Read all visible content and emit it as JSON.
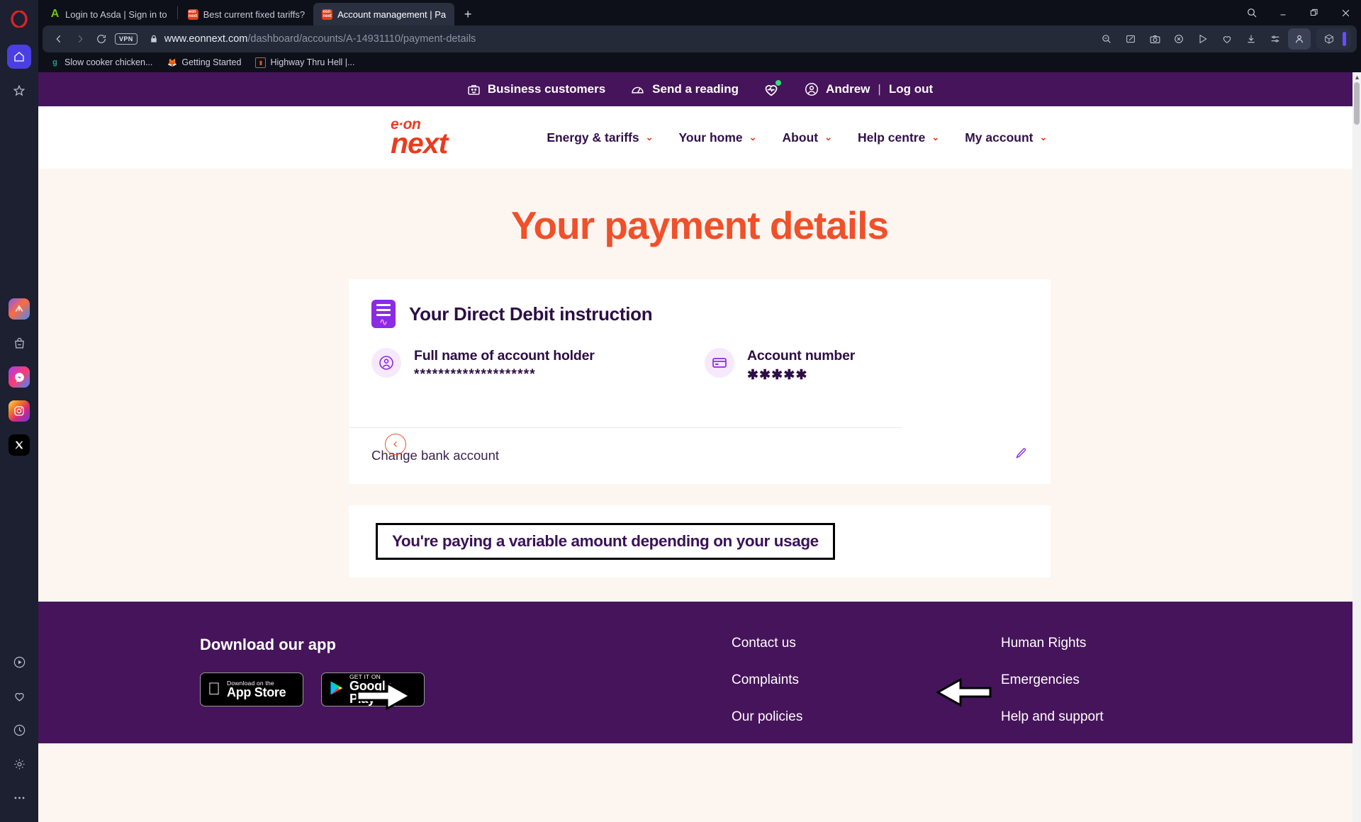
{
  "browser": {
    "tabs": [
      {
        "title": "Login to Asda | Sign in to",
        "favicon": "asda-icon",
        "active": false
      },
      {
        "title": "Best current fixed tariffs?",
        "favicon": "eonnext-icon",
        "active": false
      },
      {
        "title": "Account management | Pa",
        "favicon": "eonnext-icon",
        "active": true
      }
    ],
    "new_tab_label": "+",
    "window_controls": [
      "search-icon",
      "minimize-icon",
      "maximize-icon",
      "close-icon"
    ],
    "nav": {
      "back": "‹",
      "forward": "›",
      "reload": "↻",
      "vpn_label": "VPN",
      "lock": "lock-icon",
      "url_domain": "www.eonnext.com",
      "url_path": "/dashboard/accounts/A-14931110/payment-details"
    },
    "toolbar_icons": [
      "zoom-out-icon",
      "snapshot-edit-icon",
      "camera-icon",
      "adblock-shield-icon",
      "send-icon",
      "heart-icon",
      "download-icon",
      "settings-sliders-icon",
      "profile-icon",
      "cube-workspace-icon"
    ],
    "bookmarks": [
      {
        "label": "Slow cooker chicken...",
        "icon": "google-docs-icon"
      },
      {
        "label": "Getting Started",
        "icon": "firefox-icon"
      },
      {
        "label": "Highway Thru Hell |...",
        "icon": "video-icon"
      }
    ]
  },
  "sidebar": {
    "logo": "opera-logo-icon",
    "top_items": [
      {
        "name": "home-icon",
        "active": true
      },
      {
        "name": "star-icon",
        "active": false
      }
    ],
    "apps": [
      {
        "name": "aria-ai-icon"
      },
      {
        "name": "shopping-bag-icon"
      },
      {
        "name": "messenger-icon"
      },
      {
        "name": "instagram-icon"
      },
      {
        "name": "x-twitter-icon"
      }
    ],
    "bottom_items": [
      {
        "name": "player-icon"
      },
      {
        "name": "heart-icon"
      },
      {
        "name": "history-icon"
      },
      {
        "name": "settings-gear-icon"
      },
      {
        "name": "more-icon"
      }
    ]
  },
  "page": {
    "topbar": {
      "business": "Business customers",
      "send_reading": "Send a reading",
      "user": "Andrew",
      "separator": "|",
      "logout": "Log out"
    },
    "logo": {
      "line1": "e·on",
      "line2": "next"
    },
    "mainnav": [
      {
        "label": "Energy & tariffs",
        "chevron": "⌄"
      },
      {
        "label": "Your home",
        "chevron": "⌄"
      },
      {
        "label": "About",
        "chevron": "⌄"
      },
      {
        "label": "Help centre",
        "chevron": "⌄"
      },
      {
        "label": "My account",
        "chevron": "⌄"
      }
    ],
    "hero": {
      "back_icon": "chevron-left-icon",
      "title": "Your payment details"
    },
    "card": {
      "icon": "direct-debit-icon",
      "heading": "Your Direct Debit instruction",
      "fields": [
        {
          "icon": "person-icon",
          "label": "Full name of account holder",
          "value": "********************"
        },
        {
          "icon": "card-icon",
          "label": "Account number",
          "value": "✱✱✱✱✱"
        }
      ],
      "change_label": "Change bank account",
      "edit_icon": "pencil-icon"
    },
    "annotation": {
      "text": "You're paying a variable amount depending on your usage",
      "box_color": "#000000",
      "text_color": "#3a1258"
    },
    "footer": {
      "app_heading": "Download our app",
      "app_store": {
        "small": "Download on the",
        "big": "App Store"
      },
      "google_play": {
        "small": "GET IT ON",
        "big": "Google Play"
      },
      "links_col1": [
        "Contact us",
        "Complaints",
        "Our policies"
      ],
      "links_col2": [
        "Human Rights",
        "Emergencies",
        "Help and support"
      ]
    },
    "colors": {
      "brand_purple": "#46145a",
      "brand_orange": "#f0502a",
      "accent_violet": "#8b2be2",
      "page_bg": "#fdf6f0"
    }
  }
}
